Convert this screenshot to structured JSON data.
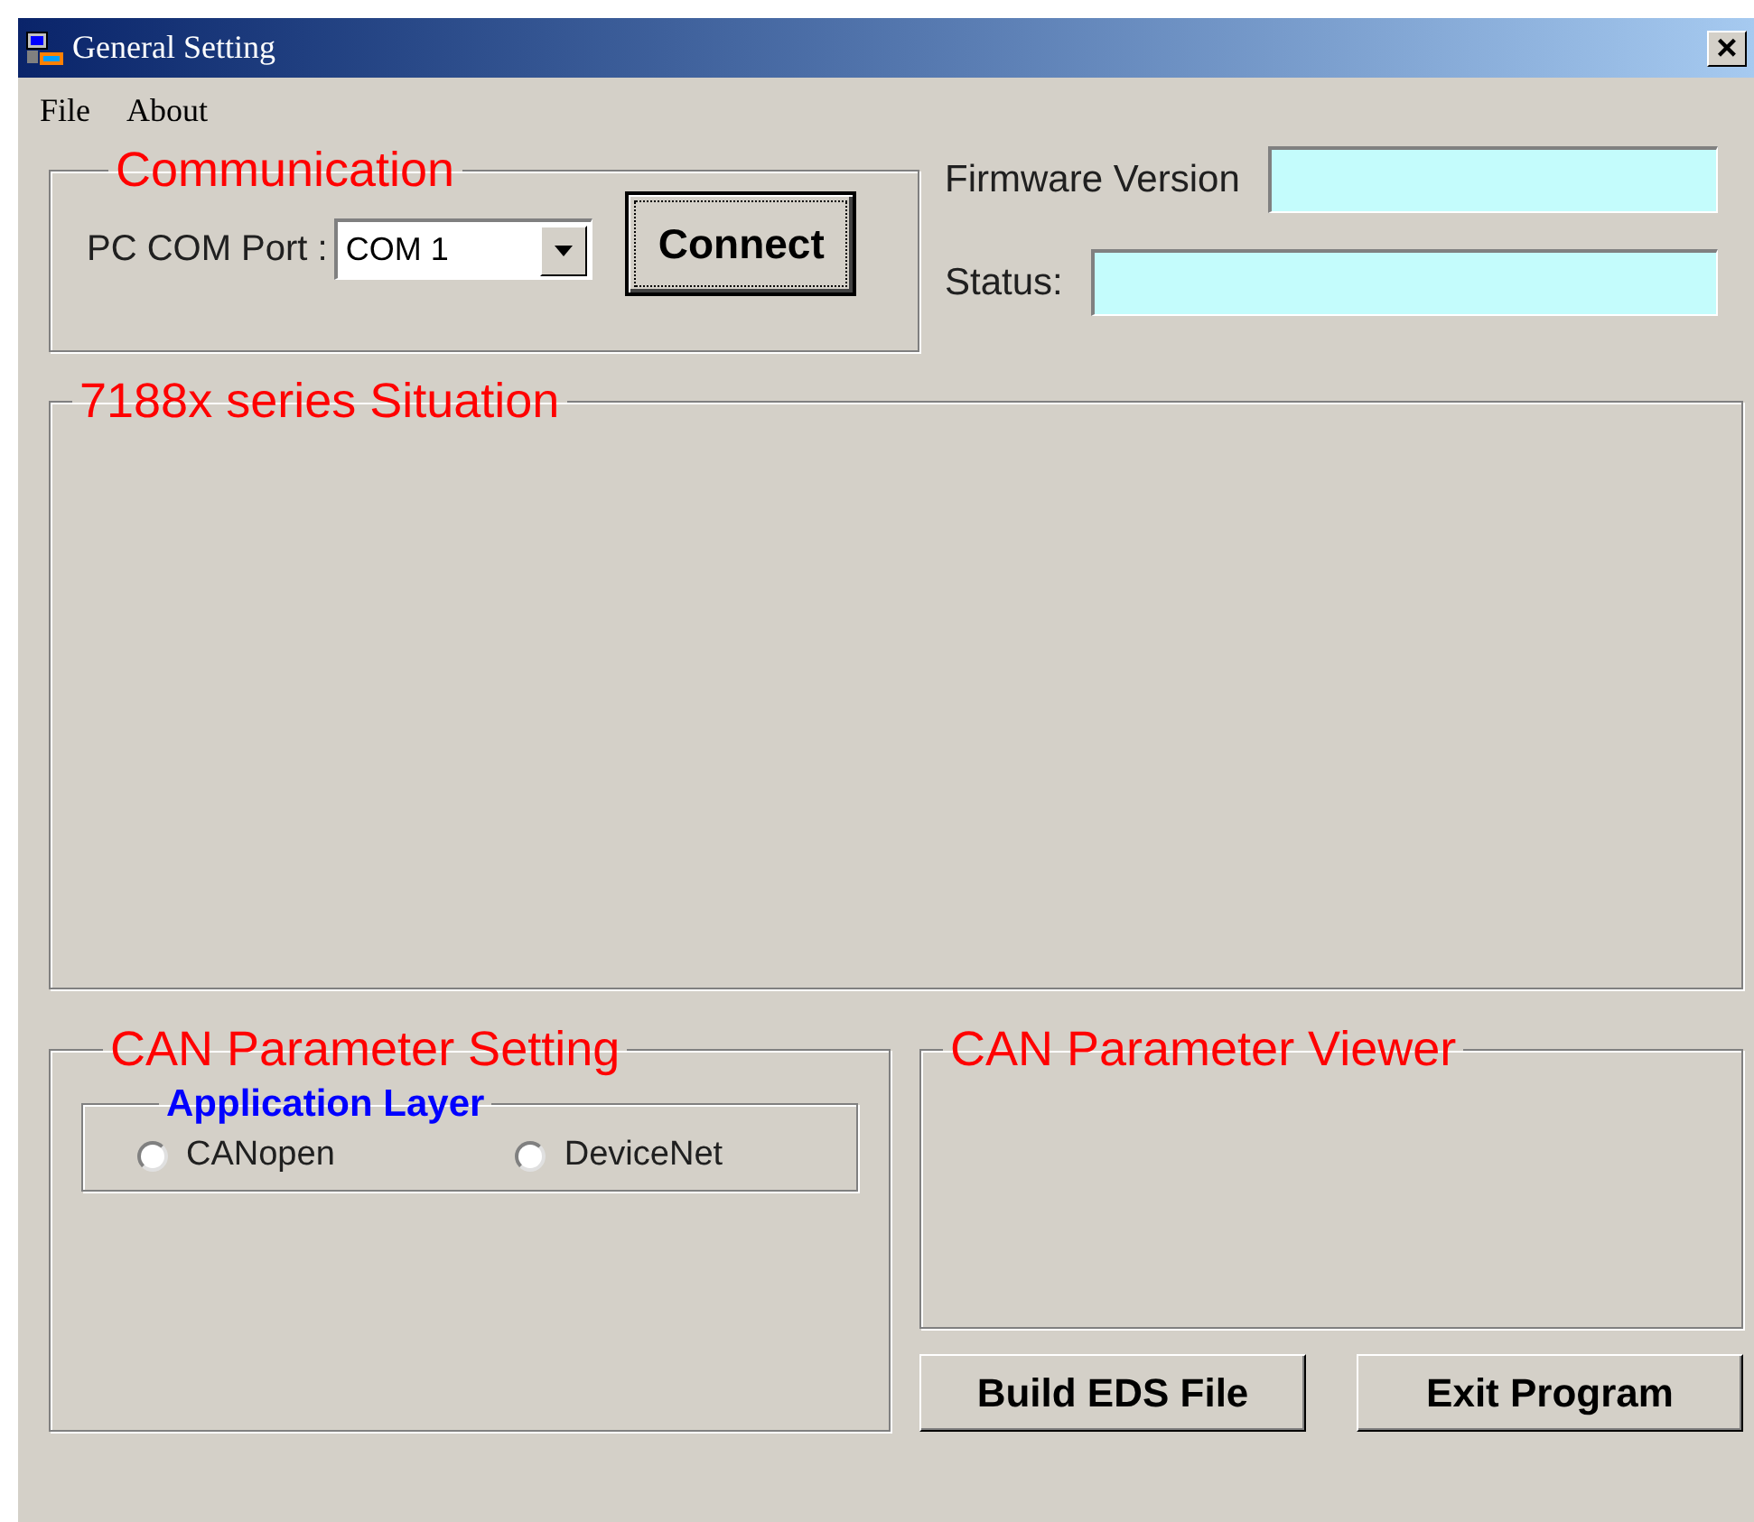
{
  "window": {
    "title": "General Setting",
    "close": "×"
  },
  "menu": [
    "File",
    "About"
  ],
  "communication": {
    "title": "Communication",
    "port_label": "PC COM Port :",
    "port_value": "COM 1",
    "connect": "Connect"
  },
  "info_fields": [
    {
      "label": "Firmware Version"
    },
    {
      "label": "Status:"
    }
  ],
  "situation": {
    "title": "7188x series Situation"
  },
  "can_setting": {
    "title": "CAN Parameter Setting",
    "layer": {
      "title": "Application Layer",
      "options": [
        {
          "label": "CANopen",
          "selected": false
        },
        {
          "label": "DeviceNet",
          "selected": false
        }
      ]
    }
  },
  "can_viewer": {
    "title": "CAN Parameter Viewer"
  },
  "buttons": [
    "Build EDS File",
    "Exit Program"
  ]
}
